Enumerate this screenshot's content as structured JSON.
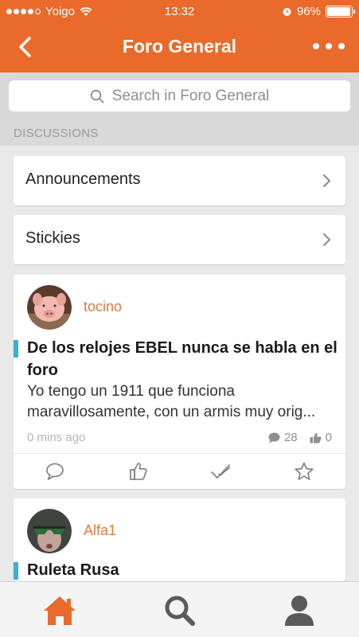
{
  "status_bar": {
    "carrier": "Yoigo",
    "time": "13:32",
    "battery": "96%",
    "battery_level": 0.96
  },
  "nav": {
    "title": "Foro General",
    "back_icon": "chevron-left-icon",
    "more_icon": "ellipsis-icon"
  },
  "search": {
    "placeholder": "Search in Foro General"
  },
  "section": {
    "label": "DISCUSSIONS"
  },
  "categories": [
    {
      "label": "Announcements"
    },
    {
      "label": "Stickies"
    }
  ],
  "posts": [
    {
      "author": "tocino",
      "title_line1": "De los relojes EBEL nunca se habla en el",
      "title_line2": "foro",
      "excerpt_line1": "Yo tengo un 1911 que funciona",
      "excerpt_line2": "maravillosamente, con un armis muy orig...",
      "time": "0 mins ago",
      "comments": "28",
      "likes": "0"
    },
    {
      "author": "Alfa1",
      "title_line1": "Ruleta Rusa"
    }
  ],
  "tabs": [
    {
      "name": "home",
      "icon": "home-icon",
      "active": true
    },
    {
      "name": "search",
      "icon": "search-icon",
      "active": false
    },
    {
      "name": "profile",
      "icon": "user-icon",
      "active": false
    }
  ],
  "colors": {
    "accent": "#e96a2a",
    "author": "#e27a3a",
    "unread_bar": "#3bb0cf",
    "background": "#e9e9e9"
  }
}
